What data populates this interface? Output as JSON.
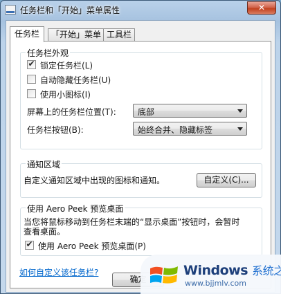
{
  "window": {
    "title": "任务栏和「开始」菜单属性",
    "close_glyph": "✕",
    "icon": "window-app-icon"
  },
  "tabs": [
    {
      "label": "任务栏",
      "active": true
    },
    {
      "label": "「开始」菜单",
      "active": false
    },
    {
      "label": "工具栏",
      "active": false
    }
  ],
  "appearance": {
    "title": "任务栏外观",
    "lock_taskbar": {
      "label": "锁定任务栏(L)",
      "checked": true
    },
    "auto_hide": {
      "label": "自动隐藏任务栏(U)",
      "checked": false
    },
    "small_icons": {
      "label": "使用小图标(I)",
      "checked": false
    },
    "location_label": "屏幕上的任务栏位置(T):",
    "location_value": "底部",
    "buttons_label": "任务栏按钮(B):",
    "buttons_value": "始终合并、隐藏标签"
  },
  "notification": {
    "title": "通知区域",
    "description": "自定义通知区域中出现的图标和通知。",
    "customize_button": "自定义(C)..."
  },
  "aero": {
    "title": "使用 Aero Peek 预览桌面",
    "description_line1": "当您将鼠标移动到任务栏末端的“显示桌面”按钮时，会暂时",
    "description_line2": "查看桌面。",
    "checkbox": {
      "label": "使用 Aero Peek 预览桌面(P)",
      "checked": true
    }
  },
  "help_link": "如何自定义该任务栏?",
  "footer": {
    "ok_button": "确定"
  },
  "watermark": {
    "brand": "Windows",
    "brand_accent": "系统之家",
    "url": "www.bjjmlv.com",
    "colors": [
      "#f25022",
      "#7fba00",
      "#00a4ef",
      "#ffb900"
    ]
  },
  "check_glyph": "✔"
}
